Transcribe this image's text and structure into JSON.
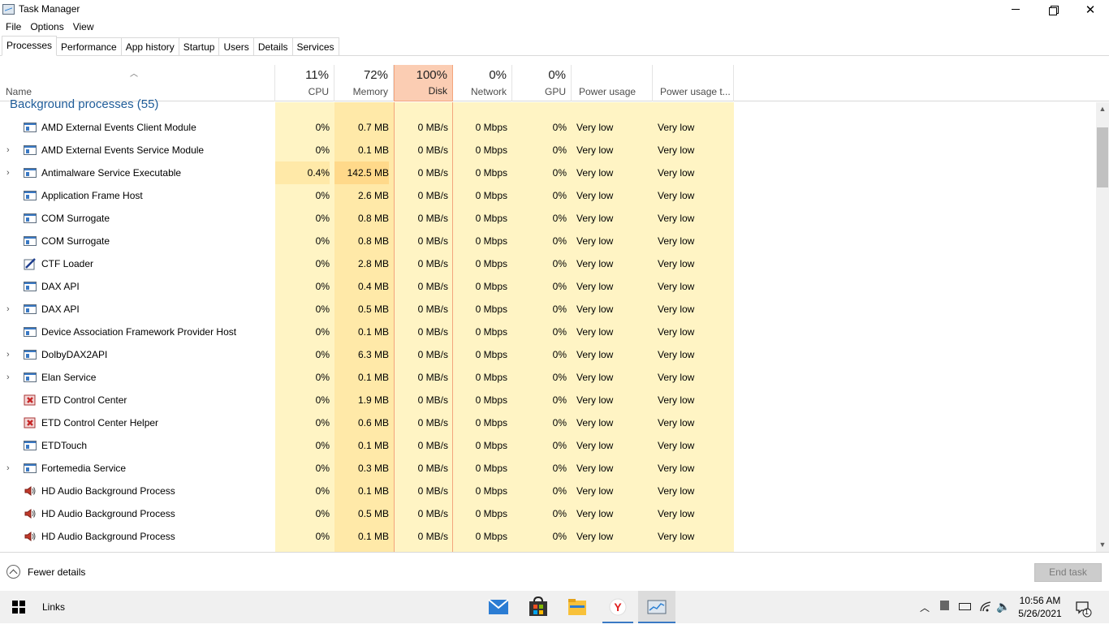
{
  "window": {
    "title": "Task Manager",
    "controls": {
      "minimize": "minimize",
      "maximize": "restore",
      "close": "close"
    }
  },
  "menu": [
    "File",
    "Options",
    "View"
  ],
  "tabs": [
    {
      "label": "Processes",
      "active": true
    },
    {
      "label": "Performance",
      "active": false
    },
    {
      "label": "App history",
      "active": false
    },
    {
      "label": "Startup",
      "active": false
    },
    {
      "label": "Users",
      "active": false
    },
    {
      "label": "Details",
      "active": false
    },
    {
      "label": "Services",
      "active": false
    }
  ],
  "columns": {
    "name": {
      "label": "Name"
    },
    "cpu": {
      "pct": "11%",
      "label": "CPU"
    },
    "memory": {
      "pct": "72%",
      "label": "Memory"
    },
    "disk": {
      "pct": "100%",
      "label": "Disk"
    },
    "network": {
      "pct": "0%",
      "label": "Network"
    },
    "gpu": {
      "pct": "0%",
      "label": "GPU"
    },
    "power": {
      "label": "Power usage"
    },
    "power_trend": {
      "label": "Power usage t..."
    }
  },
  "group": {
    "label": "Background processes (55)"
  },
  "processes": [
    {
      "name": "AMD External Events Client Module",
      "icon": "app-icon",
      "expandable": false,
      "cpu": "0%",
      "memory": "0.7 MB",
      "disk": "0 MB/s",
      "network": "0 Mbps",
      "gpu": "0%",
      "power": "Very low",
      "power_trend": "Very low"
    },
    {
      "name": "AMD External Events Service Module",
      "icon": "app-icon",
      "expandable": true,
      "cpu": "0%",
      "memory": "0.1 MB",
      "disk": "0 MB/s",
      "network": "0 Mbps",
      "gpu": "0%",
      "power": "Very low",
      "power_trend": "Very low"
    },
    {
      "name": "Antimalware Service Executable",
      "icon": "app-icon",
      "expandable": true,
      "cpu": "0.4%",
      "memory": "142.5 MB",
      "disk": "0 MB/s",
      "network": "0 Mbps",
      "gpu": "0%",
      "power": "Very low",
      "power_trend": "Very low"
    },
    {
      "name": "Application Frame Host",
      "icon": "app-icon",
      "expandable": false,
      "cpu": "0%",
      "memory": "2.6 MB",
      "disk": "0 MB/s",
      "network": "0 Mbps",
      "gpu": "0%",
      "power": "Very low",
      "power_trend": "Very low"
    },
    {
      "name": "COM Surrogate",
      "icon": "app-icon",
      "expandable": false,
      "cpu": "0%",
      "memory": "0.8 MB",
      "disk": "0 MB/s",
      "network": "0 Mbps",
      "gpu": "0%",
      "power": "Very low",
      "power_trend": "Very low"
    },
    {
      "name": "COM Surrogate",
      "icon": "app-icon",
      "expandable": false,
      "cpu": "0%",
      "memory": "0.8 MB",
      "disk": "0 MB/s",
      "network": "0 Mbps",
      "gpu": "0%",
      "power": "Very low",
      "power_trend": "Very low"
    },
    {
      "name": "CTF Loader",
      "icon": "ctf-pen-icon",
      "expandable": false,
      "cpu": "0%",
      "memory": "2.8 MB",
      "disk": "0 MB/s",
      "network": "0 Mbps",
      "gpu": "0%",
      "power": "Very low",
      "power_trend": "Very low"
    },
    {
      "name": "DAX API",
      "icon": "app-icon",
      "expandable": false,
      "cpu": "0%",
      "memory": "0.4 MB",
      "disk": "0 MB/s",
      "network": "0 Mbps",
      "gpu": "0%",
      "power": "Very low",
      "power_trend": "Very low"
    },
    {
      "name": "DAX API",
      "icon": "app-icon",
      "expandable": true,
      "cpu": "0%",
      "memory": "0.5 MB",
      "disk": "0 MB/s",
      "network": "0 Mbps",
      "gpu": "0%",
      "power": "Very low",
      "power_trend": "Very low"
    },
    {
      "name": "Device Association Framework Provider Host",
      "icon": "app-icon",
      "expandable": false,
      "cpu": "0%",
      "memory": "0.1 MB",
      "disk": "0 MB/s",
      "network": "0 Mbps",
      "gpu": "0%",
      "power": "Very low",
      "power_trend": "Very low"
    },
    {
      "name": "DolbyDAX2API",
      "icon": "app-icon",
      "expandable": true,
      "cpu": "0%",
      "memory": "6.3 MB",
      "disk": "0 MB/s",
      "network": "0 Mbps",
      "gpu": "0%",
      "power": "Very low",
      "power_trend": "Very low"
    },
    {
      "name": "Elan Service",
      "icon": "app-icon",
      "expandable": true,
      "cpu": "0%",
      "memory": "0.1 MB",
      "disk": "0 MB/s",
      "network": "0 Mbps",
      "gpu": "0%",
      "power": "Very low",
      "power_trend": "Very low"
    },
    {
      "name": "ETD Control Center",
      "icon": "etd-icon",
      "expandable": false,
      "cpu": "0%",
      "memory": "1.9 MB",
      "disk": "0 MB/s",
      "network": "0 Mbps",
      "gpu": "0%",
      "power": "Very low",
      "power_trend": "Very low"
    },
    {
      "name": "ETD Control Center Helper",
      "icon": "etd-icon",
      "expandable": false,
      "cpu": "0%",
      "memory": "0.6 MB",
      "disk": "0 MB/s",
      "network": "0 Mbps",
      "gpu": "0%",
      "power": "Very low",
      "power_trend": "Very low"
    },
    {
      "name": "ETDTouch",
      "icon": "app-icon",
      "expandable": false,
      "cpu": "0%",
      "memory": "0.1 MB",
      "disk": "0 MB/s",
      "network": "0 Mbps",
      "gpu": "0%",
      "power": "Very low",
      "power_trend": "Very low"
    },
    {
      "name": "Fortemedia Service",
      "icon": "app-icon",
      "expandable": true,
      "cpu": "0%",
      "memory": "0.3 MB",
      "disk": "0 MB/s",
      "network": "0 Mbps",
      "gpu": "0%",
      "power": "Very low",
      "power_trend": "Very low"
    },
    {
      "name": "HD Audio Background Process",
      "icon": "speaker-icon",
      "expandable": false,
      "cpu": "0%",
      "memory": "0.1 MB",
      "disk": "0 MB/s",
      "network": "0 Mbps",
      "gpu": "0%",
      "power": "Very low",
      "power_trend": "Very low"
    },
    {
      "name": "HD Audio Background Process",
      "icon": "speaker-icon",
      "expandable": false,
      "cpu": "0%",
      "memory": "0.5 MB",
      "disk": "0 MB/s",
      "network": "0 Mbps",
      "gpu": "0%",
      "power": "Very low",
      "power_trend": "Very low"
    },
    {
      "name": "HD Audio Background Process",
      "icon": "speaker-icon",
      "expandable": false,
      "cpu": "0%",
      "memory": "0.1 MB",
      "disk": "0 MB/s",
      "network": "0 Mbps",
      "gpu": "0%",
      "power": "Very low",
      "power_trend": "Very low"
    }
  ],
  "footer": {
    "fewer_details": "Fewer details",
    "end_task": "End task"
  },
  "taskbar": {
    "links": "Links",
    "apps": [
      "mail-icon",
      "store-icon",
      "file-explorer-icon",
      "yandex-browser-icon",
      "task-manager-icon"
    ],
    "clock_time": "10:56 AM",
    "clock_date": "5/26/2021",
    "notification_count": "1"
  },
  "colors": {
    "heat_low": "#fff4c4",
    "heat_mid": "#ffe9a8",
    "disk_header": "#fbcdb3",
    "group_text": "#1f5c99",
    "accent": "#3a79c4"
  }
}
